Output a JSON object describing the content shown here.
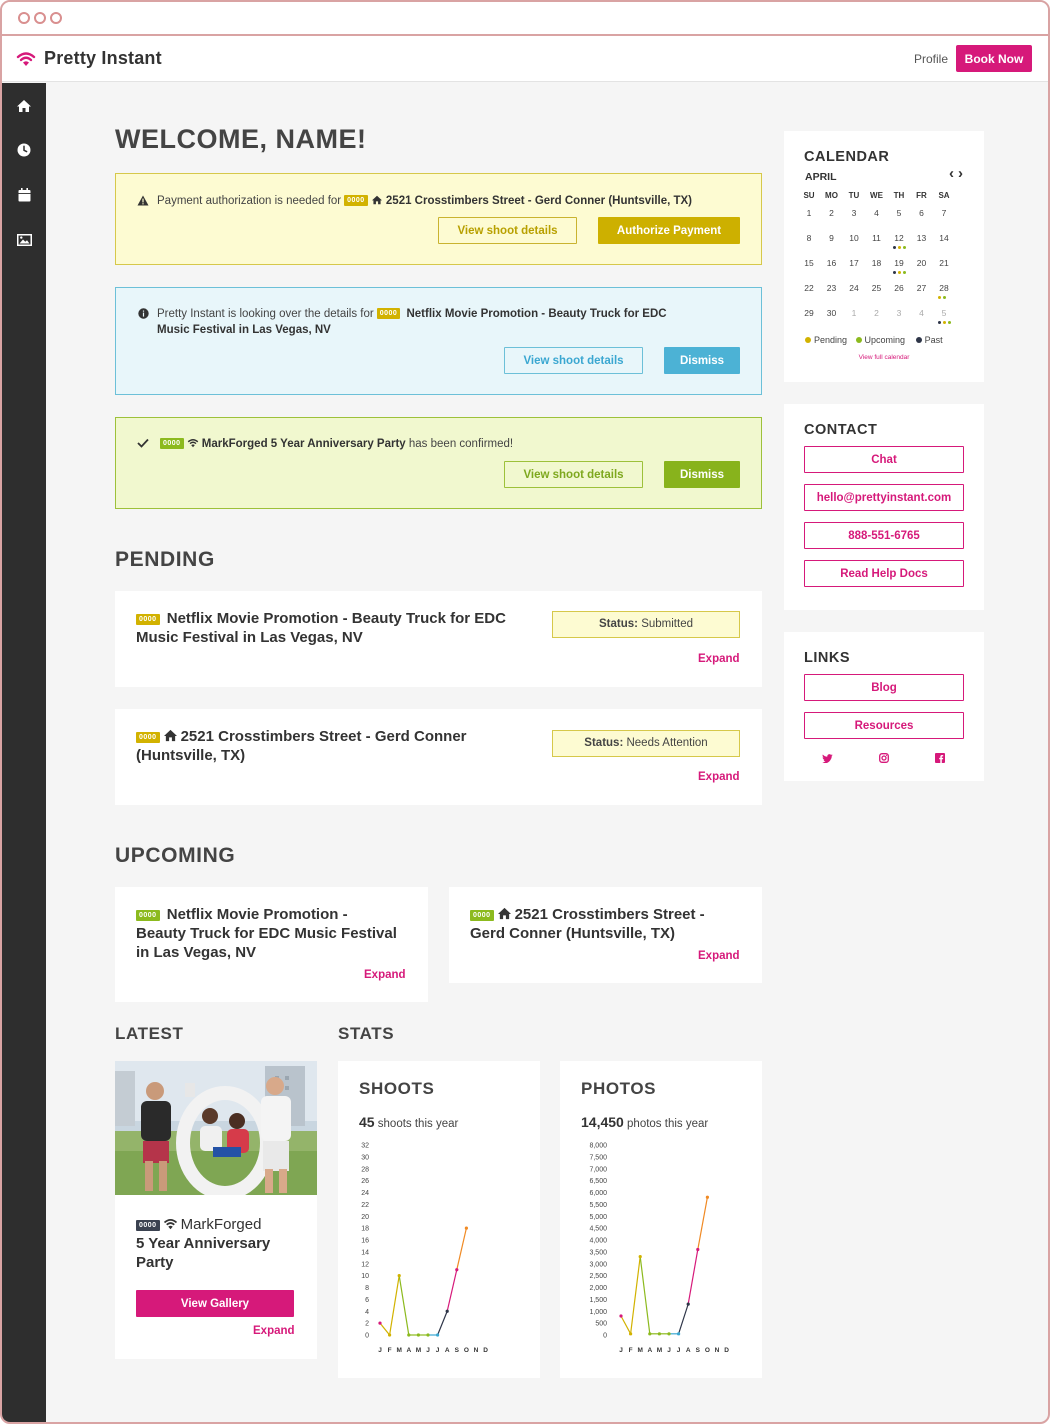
{
  "app": {
    "brand": "Pretty Instant",
    "profile_label": "Profile",
    "book_label": "Book Now",
    "brand_color": "#d6197a"
  },
  "sidebar": {
    "items": [
      {
        "icon": "home-icon"
      },
      {
        "icon": "clock-icon"
      },
      {
        "icon": "calendar-icon"
      },
      {
        "icon": "image-icon"
      }
    ]
  },
  "welcome": "WELCOME, NAME!",
  "alerts": {
    "payment": {
      "text": "Payment authorization is needed for",
      "badge": "0000",
      "target": "2521 Crosstimbers Street - Gerd Conner (Huntsville, TX)",
      "view_label": "View shoot details",
      "action_label": "Authorize Payment"
    },
    "review": {
      "text": "Pretty Instant is looking over the details for",
      "badge": "0000",
      "target_line1": "Netflix Movie Promotion - Beauty Truck for EDC",
      "target_line2": "Music Festival in Las Vegas, NV",
      "view_label": "View shoot details",
      "dismiss_label": "Dismiss"
    },
    "confirmed": {
      "badge": "0000",
      "target": "MarkForged 5 Year Anniversary Party",
      "text": "has been confirmed!",
      "view_label": "View shoot details",
      "dismiss_label": "Dismiss"
    }
  },
  "pending": {
    "heading": "PENDING",
    "items": [
      {
        "badge": "0000",
        "title_line1": "Netflix Movie Promotion - Beauty Truck for EDC",
        "title_line2": "Music Festival in Las Vegas, NV",
        "status_label": "Status:",
        "status_value": "Submitted",
        "expand": "Expand"
      },
      {
        "badge": "0000",
        "title_line1": "2521 Crosstimbers Street - Gerd Conner",
        "title_line2": "(Huntsville, TX)",
        "status_label": "Status:",
        "status_value": "Needs Attention",
        "expand": "Expand"
      }
    ]
  },
  "upcoming": {
    "heading": "UPCOMING",
    "items": [
      {
        "badge": "0000",
        "title_line1": "Netflix Movie Promotion -",
        "title_line2": "Beauty Truck for EDC Music Festival",
        "title_line3": "in Las Vegas, NV",
        "expand": "Expand"
      },
      {
        "badge": "0000",
        "title_line1": "2521 Crosstimbers Street -",
        "title_line2": "Gerd Conner (Huntsville, TX)",
        "expand": "Expand"
      }
    ]
  },
  "latest": {
    "heading": "LATEST",
    "badge": "0000",
    "title_line1": "MarkForged",
    "title_line2": "5 Year Anniversary",
    "title_line3": "Party",
    "gallery_label": "View Gallery",
    "expand": "Expand"
  },
  "stats": {
    "heading": "STATS",
    "shoots": {
      "title": "SHOOTS",
      "count": "45",
      "suffix": "shoots this year"
    },
    "photos": {
      "title": "PHOTOS",
      "count": "14,450",
      "suffix": "photos this year"
    }
  },
  "calendar": {
    "title": "CALENDAR",
    "month": "APRIL",
    "prev": "‹",
    "next": "›",
    "days": [
      "SU",
      "MO",
      "TU",
      "WE",
      "TH",
      "FR",
      "SA"
    ],
    "weeks": [
      [
        "1",
        "2",
        "3",
        "4",
        "5",
        "6",
        "7"
      ],
      [
        "8",
        "9",
        "10",
        "11",
        "12",
        "13",
        "14"
      ],
      [
        "15",
        "16",
        "17",
        "18",
        "19",
        "20",
        "21"
      ],
      [
        "22",
        "23",
        "24",
        "25",
        "26",
        "27",
        "28"
      ],
      [
        "29",
        "30",
        "1",
        "2",
        "3",
        "4",
        "5"
      ]
    ],
    "legend": {
      "pending": "Pending",
      "upcoming": "Upcoming",
      "past": "Past"
    },
    "full_link": "View full calendar",
    "colors": {
      "pending": "#d2b200",
      "upcoming": "#8cba1e",
      "past": "#2e3548"
    }
  },
  "contact": {
    "title": "CONTACT",
    "chat": "Chat",
    "email": "hello@prettyinstant.com",
    "phone": "888-551-6765",
    "docs": "Read Help Docs"
  },
  "links": {
    "title": "LINKS",
    "blog": "Blog",
    "resources": "Resources",
    "social": [
      "twitter-icon",
      "instagram-icon",
      "facebook-icon"
    ]
  },
  "chart_data": [
    {
      "type": "line",
      "title": "SHOOTS",
      "categories": [
        "J",
        "F",
        "M",
        "A",
        "M",
        "J",
        "J",
        "A",
        "S",
        "O",
        "N",
        "D"
      ],
      "yticks": [
        "32",
        "30",
        "28",
        "26",
        "24",
        "22",
        "20",
        "18",
        "16",
        "14",
        "12",
        "10",
        "8",
        "6",
        "4",
        "2",
        "0"
      ],
      "ylim": [
        0,
        32
      ],
      "values": [
        2,
        0,
        10,
        0,
        0,
        0,
        0,
        4,
        11,
        18
      ],
      "colors": [
        "#d6197a",
        "#d2b200",
        "#d2b200",
        "#8cba1e",
        "#8cba1e",
        "#8cba1e",
        "#3aa7d1",
        "#2e3548",
        "#d6197a",
        "#f08a24"
      ]
    },
    {
      "type": "line",
      "title": "PHOTOS",
      "categories": [
        "J",
        "F",
        "M",
        "A",
        "M",
        "J",
        "J",
        "A",
        "S",
        "O",
        "N",
        "D"
      ],
      "yticks": [
        "8,000",
        "7,500",
        "7,000",
        "6,500",
        "6,000",
        "5,500",
        "5,000",
        "4,500",
        "4,000",
        "3,500",
        "3,000",
        "2,500",
        "2,000",
        "1,500",
        "1,000",
        "500",
        "0"
      ],
      "ylim": [
        0,
        8000
      ],
      "values": [
        800,
        50,
        3300,
        50,
        50,
        50,
        50,
        1300,
        3600,
        5800
      ],
      "colors": [
        "#d6197a",
        "#d2b200",
        "#d2b200",
        "#8cba1e",
        "#8cba1e",
        "#8cba1e",
        "#3aa7d1",
        "#2e3548",
        "#d6197a",
        "#f08a24"
      ]
    }
  ]
}
